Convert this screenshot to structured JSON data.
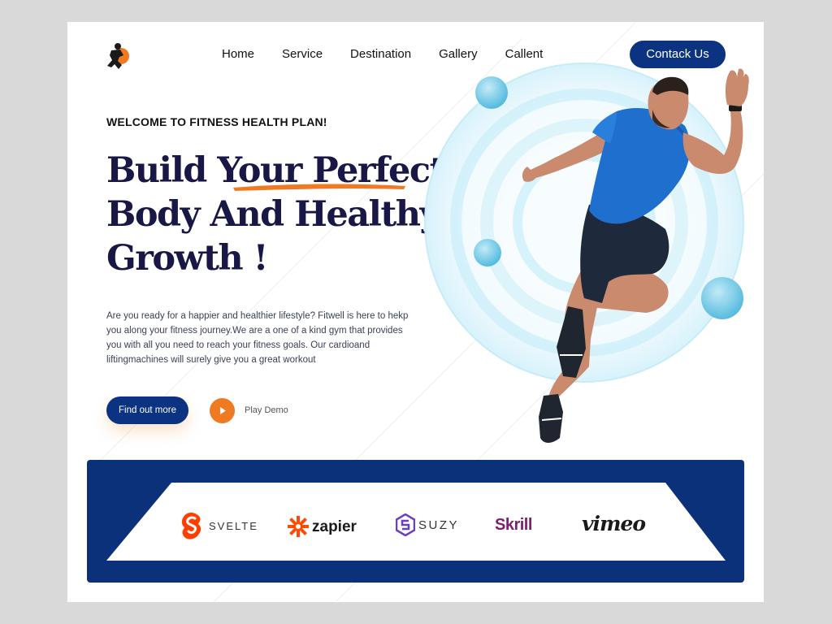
{
  "nav": {
    "items": [
      "Home",
      "Service",
      "Destination",
      "Gallery",
      "Callent"
    ],
    "contact_label": "Contack Us"
  },
  "hero": {
    "welcome": "WELCOME TO FITNESS HEALTH PLAN!",
    "headline": [
      "Build Your Perfect",
      "Body And Healthy",
      "Growth !"
    ],
    "description": "Are you ready for a happier and healthier lifestyle? Fitwell is here to hekp you along your fitness journey.We are a one of a kind gym that provides you with all you need to reach your  fitness goals. Our cardioand liftingmachines will surely give you a great workout",
    "find_out_more": "Find out more",
    "play_demo": "Play Demo"
  },
  "brands": {
    "items": [
      "SVELTE",
      "zapier",
      "SUZY",
      "Skrill",
      "vimeo"
    ]
  },
  "colors": {
    "primary": "#0b3382",
    "accent": "#ef7a22",
    "heading": "#191746",
    "ring": "#bfe9f6",
    "bubble": "#5cc0e2"
  },
  "icons": [
    "runner-logo-icon",
    "play-icon",
    "svelte-icon",
    "zapier-icon",
    "suzy-icon"
  ]
}
